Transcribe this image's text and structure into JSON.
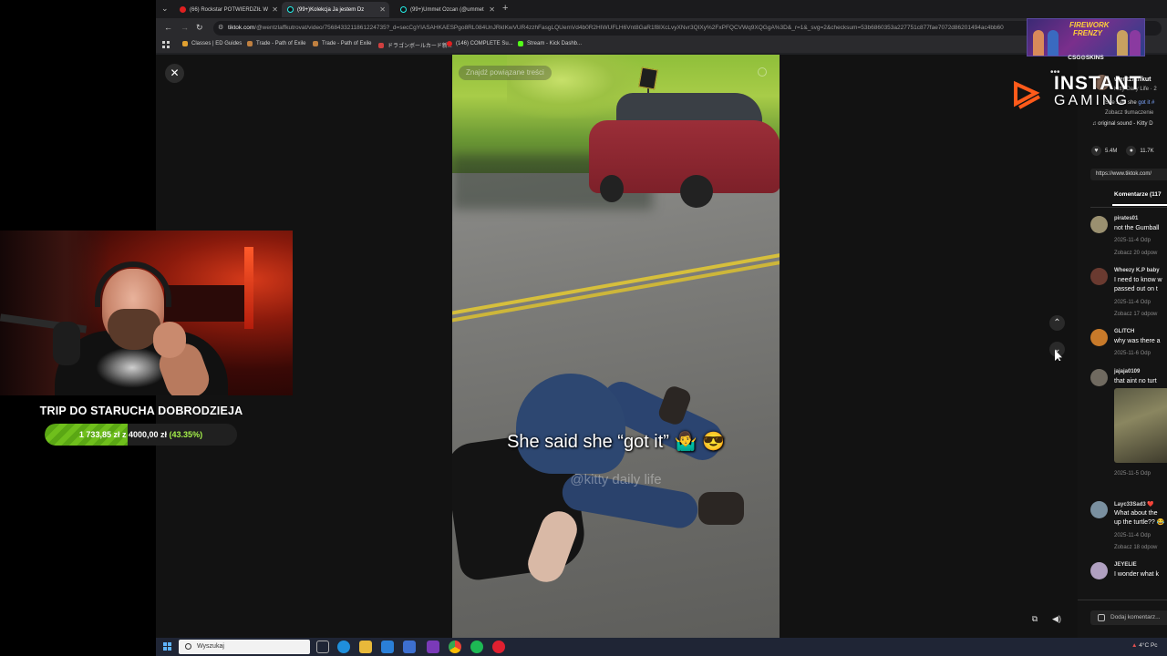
{
  "browser": {
    "tabs": [
      {
        "label": "(66) Rockstar POTWIERDZIŁ W",
        "active": false
      },
      {
        "label": "(99+)Kolekcja Ja jestem Dz",
        "active": true
      },
      {
        "label": "(99+)Ummet Ozcan (@ummet",
        "active": false
      }
    ],
    "url_host": "tiktok.com",
    "url_rest": "/@wentzlaffkutrovat/video/7568433211861224735?_d=secCgYIASAHKAESPgo8RL084UnJRkIKwVUR4zzhFasgLQUemVd4b0R2HIWUFLH6Vnt8GaR1f8IXcLvyXNvr3QIXy%2FxPFQCVWq9XQGgA%3D&_r=1&_svg=2&checksum=53b6860353a227751c877fae7072d86201494ac4bb60",
    "bookmarks": [
      {
        "label": "Classes | ED Guides",
        "color": "#e0a030"
      },
      {
        "label": "Trade - Path of Exile",
        "color": "#c08040"
      },
      {
        "label": "Trade - Path of Exile",
        "color": "#c08040"
      },
      {
        "label": "ドラゴンボールカード新...",
        "color": "#d04040"
      },
      {
        "label": "(146) COMPLETE Su...",
        "color": "#e02020"
      },
      {
        "label": "Stream - Kick Dashb...",
        "color": "#53fc18"
      }
    ]
  },
  "video": {
    "related_label": "Znajdź powiązane treści",
    "caption": "She said she “got it” 🤷‍♂️ 😎",
    "watermark": "@kitty daily life"
  },
  "nav": {
    "close": "✕",
    "up": "⌃",
    "down": "⌄"
  },
  "right_panel": {
    "author": "wentzlaffkut",
    "author_sub": "Kitty Daily Life · 2",
    "description": "She said she",
    "tag": "got it #",
    "translate": "Zobacz tłumaczenie",
    "sound": "♫ original sound - Kitty D",
    "likes": "5.4M",
    "comments_count": "11.7K",
    "link": "https://www.tiktok.com/",
    "tab_label": "Komentarze (117",
    "comments": [
      {
        "user": "pirates01",
        "text": [
          "not the Gumball"
        ],
        "meta": "2025-11-4   Odp",
        "replies": "Zobacz 20 odpow",
        "color": "#9a9070"
      },
      {
        "user": "Wheezy K.P baby",
        "text": [
          "I need to know w",
          "passed out on t"
        ],
        "meta": "2025-11-4   Odp",
        "replies": "Zobacz 17 odpow",
        "color": "#6a3a30"
      },
      {
        "user": "GLITCH",
        "text": [
          "why was there a"
        ],
        "meta": "2025-11-6   Odp",
        "replies": "",
        "color": "#c87a2a"
      },
      {
        "user": "jajaja0109",
        "text": [
          "that aint no turt"
        ],
        "meta": "2025-11-5   Odp",
        "replies": "",
        "color": "#706a60"
      },
      {
        "user": "Layc33Sad3 ❤️",
        "text": [
          "What about the",
          "up the turtle?? 😂"
        ],
        "meta": "2025-11-4   Odp",
        "replies": "Zobacz 18 odpow",
        "color": "#7a90a0"
      },
      {
        "user": "JEYELIE",
        "text": [
          "I wonder what k"
        ],
        "meta": "",
        "replies": "",
        "color": "#b0a0c0"
      }
    ],
    "add_comment": "Dodaj komentarz..."
  },
  "overlay": {
    "brand_top": "INSTANT",
    "brand_bottom": "GAMING",
    "banner_line1": "FIREWORK",
    "banner_line2": "FRENZY",
    "banner_sponsor": "CSG⊙SKINS"
  },
  "goal": {
    "title": "TRIP DO STARUCHA DOBRODZIEJA",
    "current": "1 733,85 zł",
    "sep": " z ",
    "target": "4000,00 zł",
    "percent_label": "(43.35%)",
    "progress": 0.4335
  },
  "taskbar": {
    "search_placeholder": "Wyszukaj",
    "tray": "4°C  Pc"
  }
}
